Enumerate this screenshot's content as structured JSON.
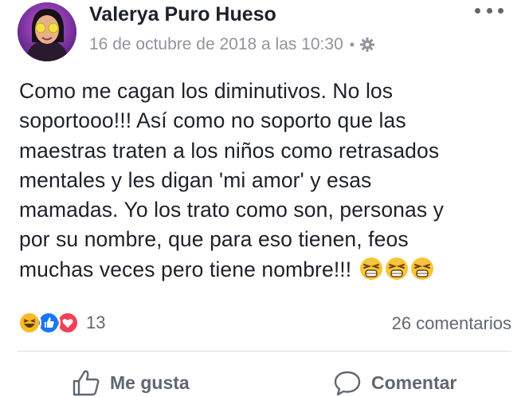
{
  "post": {
    "author": "Valerya Puro Hueso",
    "timestamp": "16 de octubre de 2018 a las 10:30",
    "separator": "•",
    "privacy_icon": "gear-icon",
    "text_lines": [
      "Como me cagan los diminutivos. No los",
      "soportooo!!! Así como no soporto que las",
      "maestras traten a los niños como retrasados",
      "mentales y les digan 'mi amor' y esas",
      "mamadas. Yo los trato como son, personas y",
      "por su nombre, que para eso tienen, feos",
      "muchas veces pero tiene nombre!!!"
    ],
    "trailing_emojis": [
      "tired-face-emoji",
      "tired-face-emoji",
      "tired-face-emoji"
    ]
  },
  "reactions": {
    "types": [
      "haha",
      "like",
      "love"
    ],
    "count": "13"
  },
  "comments": {
    "label": "26 comentarios"
  },
  "actions": {
    "like_label": "Me gusta",
    "comment_label": "Comentar"
  },
  "colors": {
    "like_blue": "#1877f2",
    "love_red": "#f33e58",
    "haha_yellow": "#f7b928",
    "secondary_text": "#606770",
    "meta_text": "#90949c"
  }
}
